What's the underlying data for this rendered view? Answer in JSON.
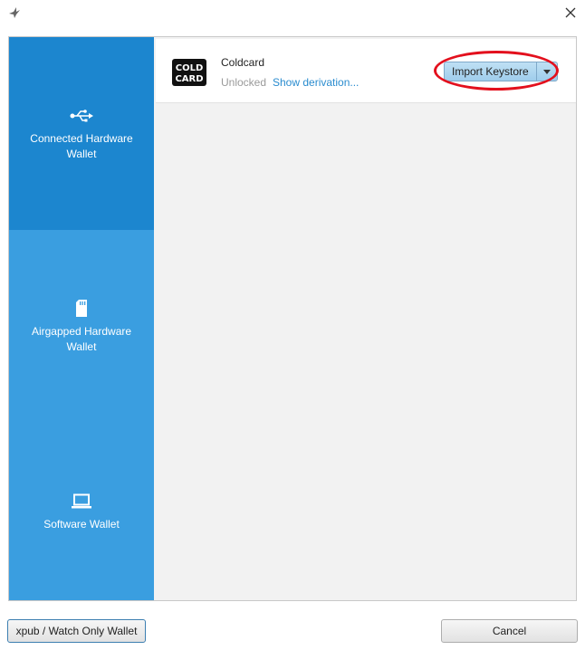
{
  "window": {
    "icon": "sparrow-bird-icon",
    "close_icon": "close-icon"
  },
  "sidebar": {
    "items": [
      {
        "label": "Connected Hardware Wallet",
        "icon": "usb-icon",
        "active": true
      },
      {
        "label": "Airgapped Hardware Wallet",
        "icon": "sd-card-icon",
        "active": false
      },
      {
        "label": "Software Wallet",
        "icon": "laptop-icon",
        "active": false
      }
    ]
  },
  "device": {
    "logo_text": "COLD\nCARD",
    "name": "Coldcard",
    "status": "Unlocked",
    "show_derivation": "Show derivation...",
    "import_button": "Import Keystore",
    "dropdown_icon": "chevron-down-icon"
  },
  "annotation": {
    "color": "#e3101d"
  },
  "footer": {
    "xpub_button": "xpub / Watch Only Wallet",
    "cancel_button": "Cancel"
  },
  "colors": {
    "sidebar": "#3a9ee0",
    "sidebar_active": "#1c86cf",
    "link": "#2a8ccf"
  }
}
